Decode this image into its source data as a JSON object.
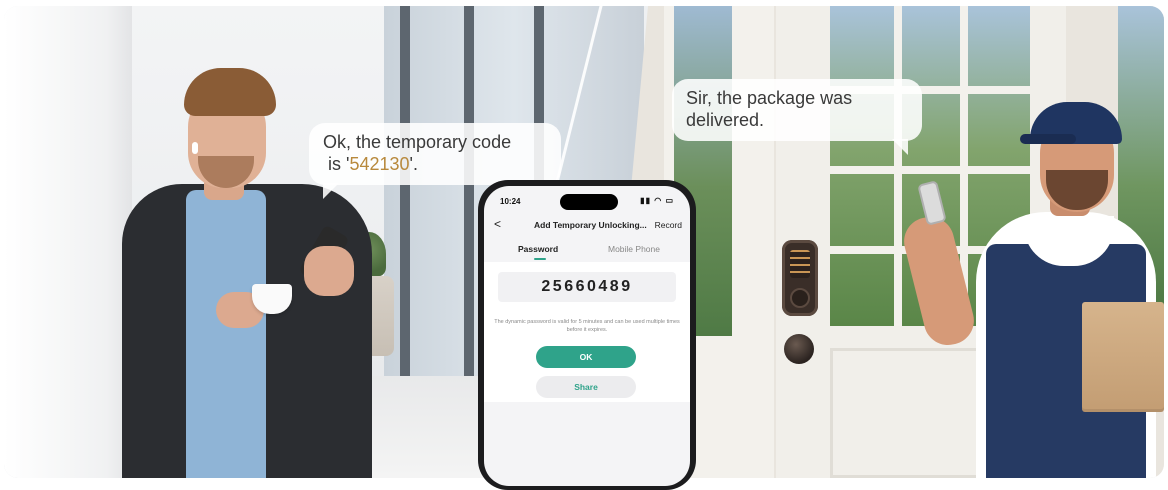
{
  "left_bubble": {
    "line1": "Ok, the temporary code",
    "prefix": " is '",
    "code": "542130",
    "suffix": "'."
  },
  "right_bubble": {
    "line1": "Sir, the package was",
    "line2": "delivered."
  },
  "phone": {
    "status": {
      "time": "10:24",
      "icons": "signal wifi battery"
    },
    "nav": {
      "back": "<",
      "title": "Add Temporary Unlocking...",
      "record": "Record"
    },
    "tabs": [
      {
        "label": "Password",
        "active": true
      },
      {
        "label": "Mobile Phone",
        "active": false
      }
    ],
    "password": "25660489",
    "info": "The dynamic password is valid for 5 minutes and can be used multiple times before it expires.",
    "ok_label": "OK",
    "share_label": "Share"
  },
  "colors": {
    "accent": "#2fa38a",
    "code_highlight": "#b8893c",
    "cap": "#1f3561",
    "overalls": "#263a63"
  }
}
